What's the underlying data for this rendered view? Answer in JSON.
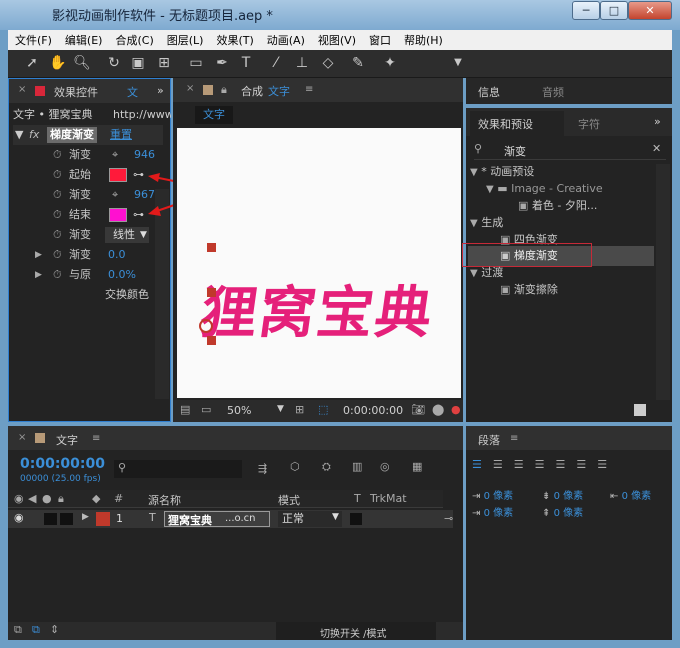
{
  "window": {
    "title": "影视动画制作软件 - 无标题项目.aep *",
    "controls": [
      "─",
      "□",
      "✕"
    ]
  },
  "menu": [
    "文件(F)",
    "编辑(E)",
    "合成(C)",
    "图层(L)",
    "效果(T)",
    "动画(A)",
    "视图(V)",
    "窗口",
    "帮助(H)"
  ],
  "effects_panel": {
    "tab": "效果控件",
    "tab2": "文",
    "subtitle": "文字 • 狸窝宝典",
    "subtitle_right": "http://www.",
    "fx": "fx",
    "effect_name": "梯度渐变",
    "reset": "重置",
    "rows": [
      {
        "label": "渐变",
        "value": "946"
      },
      {
        "label": "起始",
        "color": "#ff1a3a"
      },
      {
        "label": "渐变",
        "value": "967"
      },
      {
        "label": "结束",
        "color": "#ff10d0"
      },
      {
        "label": "渐变",
        "value": "线性"
      },
      {
        "label": "渐变",
        "value": "0.0"
      },
      {
        "label": "与原",
        "value": "0.0%"
      }
    ],
    "swap": "交换颜色"
  },
  "comp_panel": {
    "tab": "合成",
    "tab_name": "文字",
    "chip": "文字",
    "canvas_text": "狸窝宝典",
    "zoom": "50%",
    "time": "0:00:00:00"
  },
  "info_panel": {
    "tabs": [
      "信息",
      "音频"
    ]
  },
  "presets_panel": {
    "tabs": [
      "效果和预设",
      "字符"
    ],
    "search": "渐变",
    "tree": [
      {
        "label": "* 动画预设",
        "level": 0,
        "type": "twirl"
      },
      {
        "label": "Image - Creative",
        "level": 1,
        "type": "folder"
      },
      {
        "label": "着色 - 夕阳...",
        "level": 2,
        "type": "item"
      },
      {
        "label": "生成",
        "level": 0,
        "type": "twirl"
      },
      {
        "label": "四色渐变",
        "level": 1,
        "type": "fx"
      },
      {
        "label": "梯度渐变",
        "level": 1,
        "type": "fx"
      },
      {
        "label": "过渡",
        "level": 0,
        "type": "twirl"
      },
      {
        "label": "渐变擦除",
        "level": 1,
        "type": "fx"
      }
    ]
  },
  "timeline": {
    "tab": "文字",
    "time": "0:00:00:00",
    "fps": "00000 (25.00 fps)",
    "search_icon": "search-icon",
    "cols": {
      "num": "#",
      "source": "源名称",
      "mode": "模式",
      "t": "T",
      "trkmat": "TrkMat"
    },
    "layer": {
      "num": "1",
      "name": "狸窝宝典",
      "name_suffix": "...o.cn",
      "mode": "正常"
    },
    "footer": "切换开关 /模式"
  },
  "paragraph_panel": {
    "tab": "段落",
    "px": [
      "0 像素",
      "0 像素",
      "0 像素",
      "0 像素",
      "0 像素"
    ]
  },
  "colors": {
    "accent_red": "#d8273a",
    "highlight": "#c62a38",
    "panel": "#232323",
    "title_blue": "#7eaad0"
  }
}
